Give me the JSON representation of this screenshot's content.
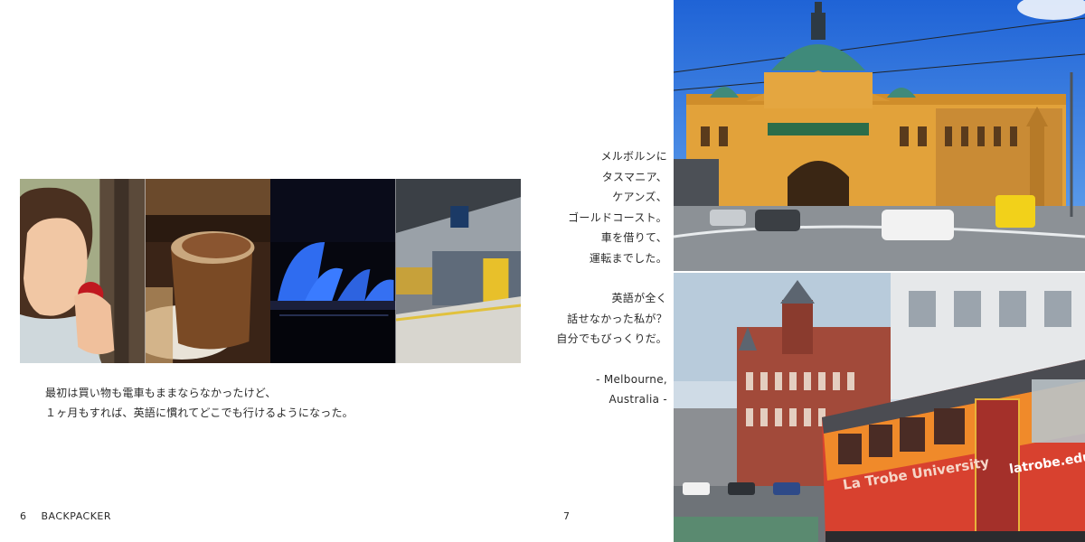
{
  "left_page": {
    "photos": [
      {
        "icon": "woman-eating-apple-photo"
      },
      {
        "icon": "hot-chocolate-photo"
      },
      {
        "icon": "sydney-opera-house-night-photo"
      },
      {
        "icon": "train-station-platform-photo"
      }
    ],
    "caption": [
      "最初は買い物も電車もままならなかったけど、",
      "１ヶ月もすれば、英語に慣れてどこでも行けるようになった。"
    ],
    "page_number": "6",
    "running_title": "BACKPACKER"
  },
  "right_page": {
    "page_number": "7",
    "stanza1": [
      "メルボルンに",
      "タスマニア、",
      "ケアンズ、",
      "ゴールドコースト。",
      "車を借りて、",
      "運転までした。"
    ],
    "stanza2": [
      "英語が全く",
      "話せなかった私が？",
      "自分でもびっくりだ。"
    ],
    "place": [
      "- Melbourne,",
      "Australia -"
    ],
    "photos": {
      "top": {
        "icon": "flinders-street-station-photo"
      },
      "bottom": {
        "icon": "melbourne-tram-street-photo"
      },
      "tram_text": "La Trobe University",
      "tram_text2": "latrobe.edu"
    }
  }
}
